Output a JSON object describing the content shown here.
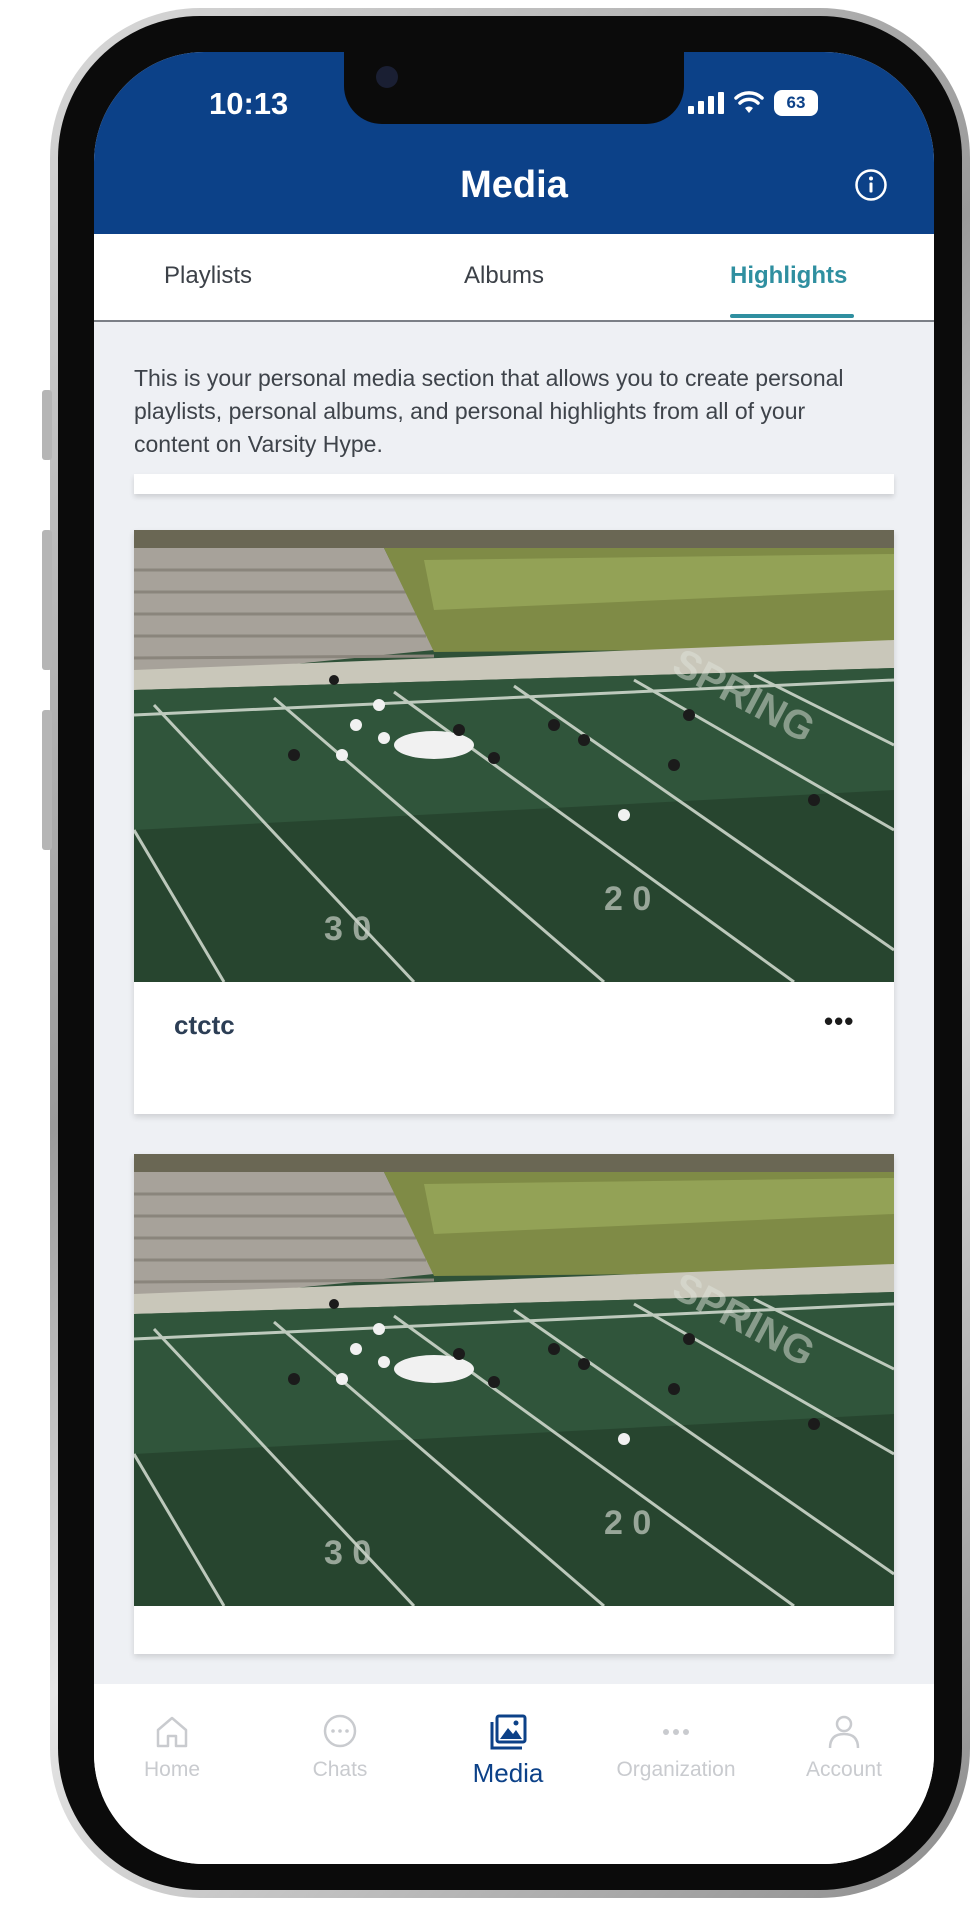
{
  "status_bar": {
    "time": "10:13",
    "battery": "63"
  },
  "header": {
    "title": "Media",
    "info_icon": "info-circle-icon"
  },
  "tabs": [
    {
      "label": "Playlists",
      "active": false
    },
    {
      "label": "Albums",
      "active": false
    },
    {
      "label": "Highlights",
      "active": true
    }
  ],
  "intro_text": "This is your personal media section that allows you to create personal playlists, personal albums, and personal highlights from all of your content on Varsity Hype.",
  "highlights": [
    {
      "title": "ctctc",
      "more_label": "•••",
      "thumbnail": "football-field-thumbnail"
    },
    {
      "title": "",
      "thumbnail": "football-field-thumbnail"
    }
  ],
  "bottom_nav": [
    {
      "label": "Home",
      "icon": "home-icon",
      "active": false
    },
    {
      "label": "Chats",
      "icon": "chat-bubble-icon",
      "active": false
    },
    {
      "label": "Media",
      "icon": "media-gallery-icon",
      "active": true
    },
    {
      "label": "Organization",
      "icon": "ellipsis-icon",
      "active": false
    },
    {
      "label": "Account",
      "icon": "user-icon",
      "active": false
    }
  ],
  "colors": {
    "header": "#0c4188",
    "accent": "#2f8fa0",
    "field": "#2e4f35",
    "content_bg": "#eef0f4"
  }
}
